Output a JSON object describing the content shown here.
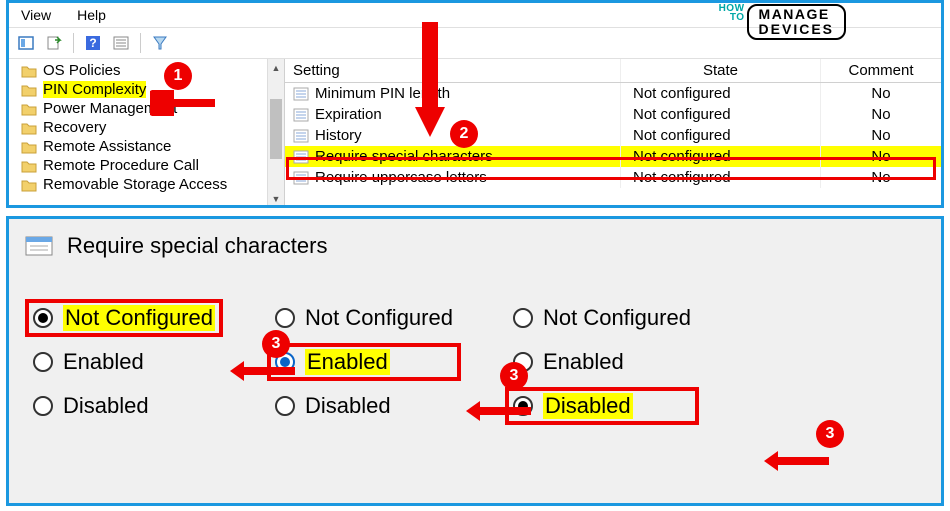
{
  "menu": {
    "view": "View",
    "help": "Help"
  },
  "tree": {
    "items": [
      {
        "label": "OS Policies"
      },
      {
        "label": "PIN Complexity",
        "hl": true
      },
      {
        "label": "Power Management"
      },
      {
        "label": "Recovery"
      },
      {
        "label": "Remote Assistance"
      },
      {
        "label": "Remote Procedure Call"
      },
      {
        "label": "Removable Storage Access"
      }
    ]
  },
  "list": {
    "headers": {
      "setting": "Setting",
      "state": "State",
      "comment": "Comment"
    },
    "rows": [
      {
        "setting": "Minimum PIN length",
        "state": "Not configured",
        "comment": "No"
      },
      {
        "setting": "Expiration",
        "state": "Not configured",
        "comment": "No"
      },
      {
        "setting": "History",
        "state": "Not configured",
        "comment": "No"
      },
      {
        "setting": "Require special characters",
        "state": "Not configured",
        "comment": "No",
        "hl": true
      },
      {
        "setting": "Require uppercase letters",
        "state": "Not configured",
        "comment": "No"
      }
    ]
  },
  "dialog": {
    "title": "Require special characters",
    "groups": [
      {
        "options": [
          {
            "label": "Not Configured",
            "selected": true,
            "hl": true,
            "boxed": true,
            "color": "black"
          },
          {
            "label": "Enabled"
          },
          {
            "label": "Disabled"
          }
        ]
      },
      {
        "options": [
          {
            "label": "Not Configured"
          },
          {
            "label": "Enabled",
            "selected": true,
            "hl": true,
            "boxed": true,
            "color": "blue"
          },
          {
            "label": "Disabled"
          }
        ]
      },
      {
        "options": [
          {
            "label": "Not Configured"
          },
          {
            "label": "Enabled"
          },
          {
            "label": "Disabled",
            "selected": true,
            "hl": true,
            "boxed": true,
            "color": "black"
          }
        ]
      }
    ],
    "badge3": "3"
  },
  "badges": {
    "b1": "1",
    "b2": "2"
  },
  "logo": {
    "how": "HOW",
    "to": "TO",
    "manage": "MANAGE",
    "devices": "DEVICES"
  }
}
